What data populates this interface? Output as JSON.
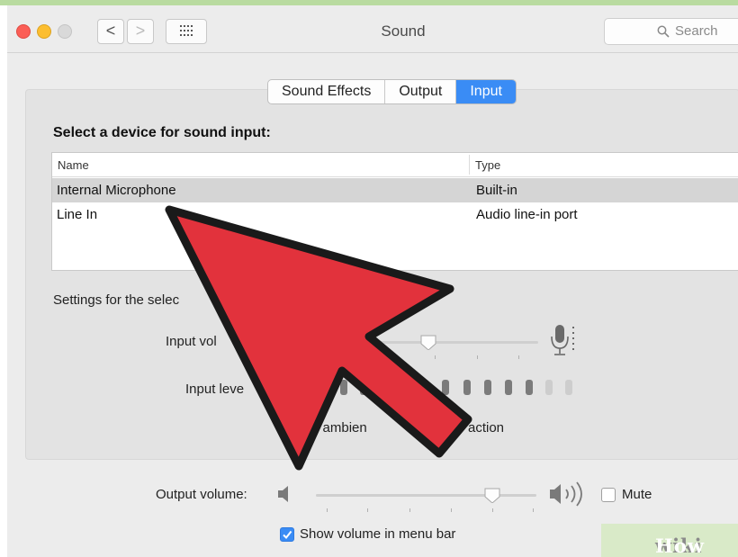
{
  "window": {
    "title": "Sound"
  },
  "toolbar": {
    "back_glyph": "<",
    "forward_glyph": ">",
    "search_placeholder": "Search"
  },
  "tabs": [
    {
      "label": "Sound Effects",
      "active": false
    },
    {
      "label": "Output",
      "active": false
    },
    {
      "label": "Input",
      "active": true
    }
  ],
  "input": {
    "heading": "Select a device for sound input:",
    "columns": {
      "name": "Name",
      "type": "Type"
    },
    "devices": [
      {
        "name": "Internal Microphone",
        "type": "Built-in",
        "selected": true
      },
      {
        "name": "Line In",
        "type": "Audio line-in port",
        "selected": false
      }
    ],
    "settings_label": "Settings for the selec",
    "input_volume_label": "Input vol",
    "input_level_label": "Input leve",
    "noise_reduction_label_left": "e ambien",
    "noise_reduction_label_right": "action"
  },
  "output": {
    "volume_label": "Output volume:",
    "volume_level": 0.79,
    "mute_label": "Mute",
    "mute_checked": false,
    "show_volume_label": "Show volume in menu bar",
    "show_volume_checked": true
  },
  "watermark": {
    "wiki": "wiki",
    "how": "How"
  },
  "colors": {
    "accent": "#3a8cf5",
    "arrow_fill": "#e2323c",
    "arrow_outline": "#1a1a1a"
  }
}
